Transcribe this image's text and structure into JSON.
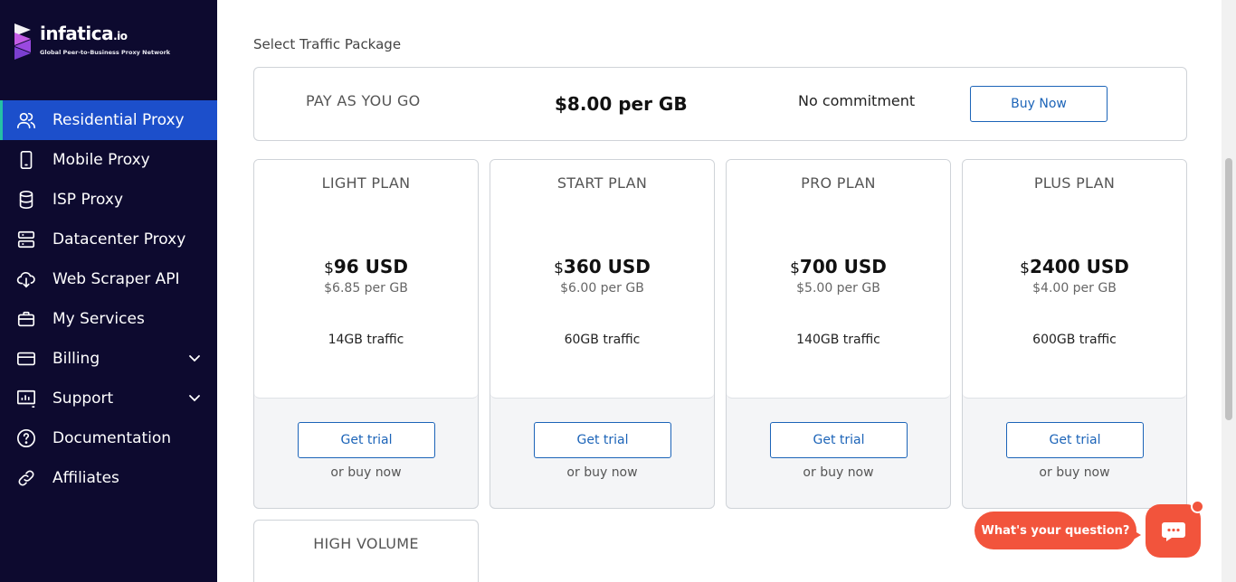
{
  "brand": {
    "name": "infatica",
    "suffix": ".io",
    "tagline": "Global Peer-to-Business Proxy Network"
  },
  "sidebar": {
    "items": [
      {
        "label": "Residential Proxy",
        "icon": "users-icon",
        "active": true
      },
      {
        "label": "Mobile Proxy",
        "icon": "mobile-icon"
      },
      {
        "label": "ISP Proxy",
        "icon": "database-icon"
      },
      {
        "label": "Datacenter Proxy",
        "icon": "server-icon"
      },
      {
        "label": "Web Scraper API",
        "icon": "cloud-download-icon"
      },
      {
        "label": "My Services",
        "icon": "briefcase-icon"
      },
      {
        "label": "Billing",
        "icon": "credit-card-icon",
        "expandable": true
      },
      {
        "label": "Support",
        "icon": "chart-icon",
        "expandable": true
      },
      {
        "label": "Documentation",
        "icon": "help-circle-icon"
      },
      {
        "label": "Affiliates",
        "icon": "link-icon"
      }
    ]
  },
  "main": {
    "section_title": "Select Traffic Package",
    "payg": {
      "name": "PAY AS YOU GO",
      "price": "$8.00 per GB",
      "commitment": "No commitment",
      "button": "Buy Now"
    },
    "plans": [
      {
        "name": "LIGHT PLAN",
        "currency": "$",
        "amount": "96 USD",
        "per_gb": "$6.85 per GB",
        "traffic": "14GB traffic",
        "trial": "Get trial",
        "buy": "or buy now"
      },
      {
        "name": "START PLAN",
        "currency": "$",
        "amount": "360 USD",
        "per_gb": "$6.00 per GB",
        "traffic": "60GB traffic",
        "trial": "Get trial",
        "buy": "or buy now"
      },
      {
        "name": "PRO PLAN",
        "currency": "$",
        "amount": "700 USD",
        "per_gb": "$5.00 per GB",
        "traffic": "140GB traffic",
        "trial": "Get trial",
        "buy": "or buy now"
      },
      {
        "name": "PLUS PLAN",
        "currency": "$",
        "amount": "2400 USD",
        "per_gb": "$4.00 per GB",
        "traffic": "600GB traffic",
        "trial": "Get trial",
        "buy": "or buy now"
      }
    ],
    "high_volume": {
      "name": "HIGH VOLUME"
    }
  },
  "chat": {
    "prompt": "What's your question?",
    "icon": "chat-icon"
  },
  "colors": {
    "sidebar_bg": "#0d0a2f",
    "active_bg": "#1c4fcb",
    "accent": "#1c64b8",
    "chat": "#f2543c"
  }
}
